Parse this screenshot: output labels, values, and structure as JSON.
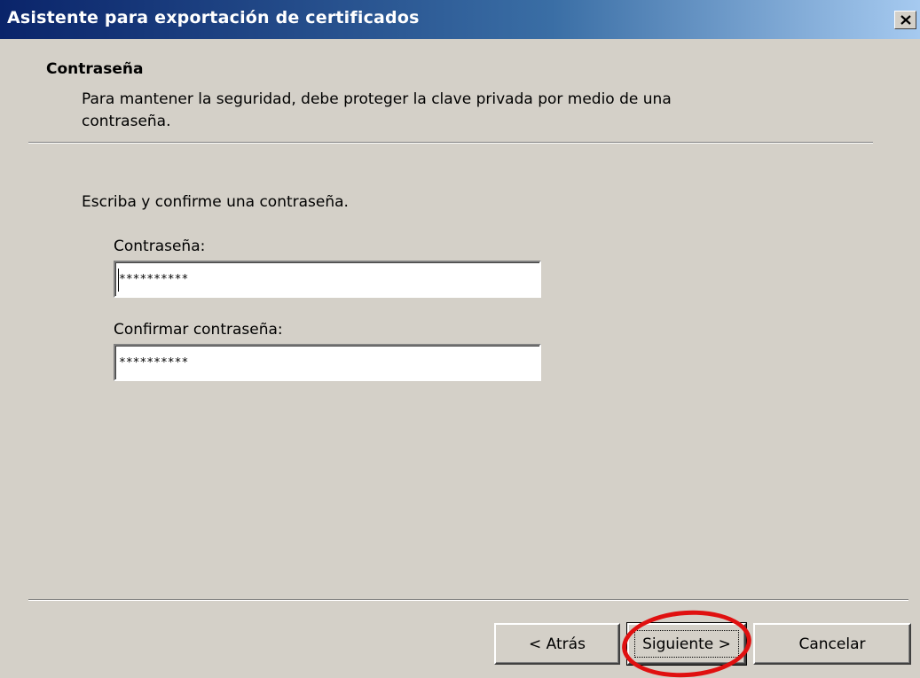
{
  "window": {
    "title": "Asistente para exportación de certificados",
    "close_icon": "close-icon"
  },
  "header": {
    "section_title": "Contraseña",
    "description": "Para mantener la seguridad, debe proteger la clave privada por medio de una contraseña."
  },
  "form": {
    "instruction": "Escriba y confirme una contraseña.",
    "password_label": "Contraseña:",
    "password_value": "**********",
    "confirm_label": "Confirmar contraseña:",
    "confirm_value": "**********"
  },
  "buttons": {
    "back_label": "< Atrás",
    "next_label": "Siguiente >",
    "cancel_label": "Cancelar"
  },
  "colors": {
    "titlebar_start": "#0a246a",
    "titlebar_end": "#a6caf0",
    "window_bg": "#d4d0c8",
    "highlight_ring": "#e01010"
  }
}
